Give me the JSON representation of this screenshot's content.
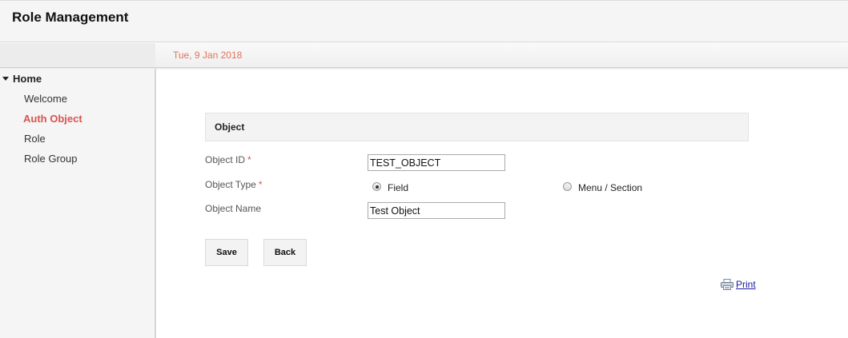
{
  "header": {
    "title": "Role Management"
  },
  "date_bar": {
    "date": "Tue, 9 Jan 2018"
  },
  "sidebar": {
    "home_label": "Home",
    "items": [
      {
        "label": "Welcome",
        "active": false
      },
      {
        "label": "Auth Object",
        "active": true
      },
      {
        "label": "Role",
        "active": false
      },
      {
        "label": "Role Group",
        "active": false
      }
    ]
  },
  "form": {
    "section_title": "Object",
    "object_id": {
      "label": "Object ID",
      "required": "*",
      "value": "TEST_OBJECT"
    },
    "object_type": {
      "label": "Object Type",
      "required": "*",
      "options": [
        {
          "label": "Field",
          "selected": true
        },
        {
          "label": "Menu / Section",
          "selected": false
        }
      ]
    },
    "object_name": {
      "label": "Object Name",
      "value": "Test Object"
    }
  },
  "buttons": {
    "save": "Save",
    "back": "Back"
  },
  "print": {
    "label": "Print",
    "icon": "print-icon"
  },
  "colors": {
    "accent": "#d9534f",
    "date": "#e0735a",
    "link": "#1a1aa6"
  }
}
